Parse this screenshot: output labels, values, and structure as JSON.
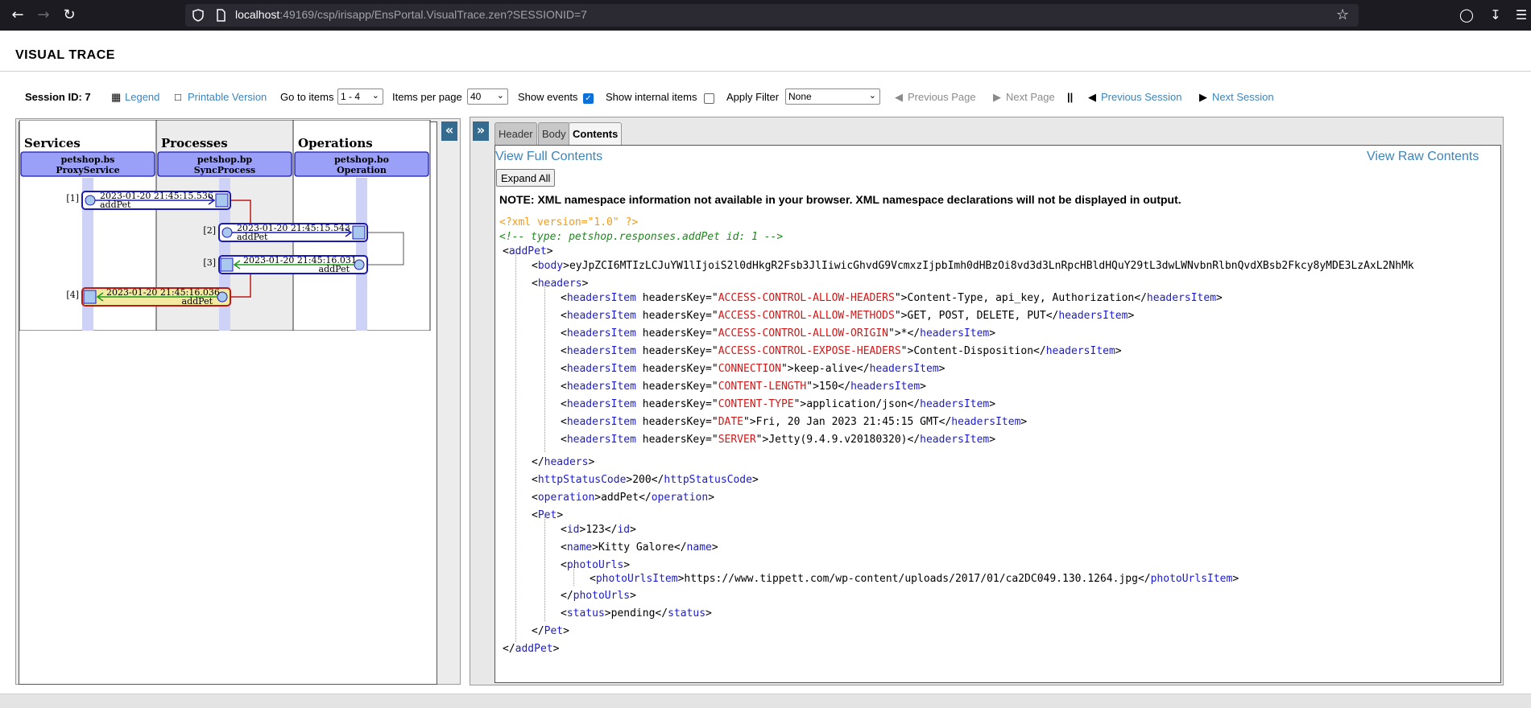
{
  "browser": {
    "url_host": "localhost",
    "url_rest": ":49169/csp/irisapp/EnsPortal.VisualTrace.zen?SESSIONID=7"
  },
  "page": {
    "title": "VISUAL TRACE"
  },
  "toolbar": {
    "session_id": "Session ID: 7",
    "legend": "Legend",
    "printable": "Printable Version",
    "goto_label": "Go to items",
    "goto_value": "1 - 4",
    "per_page_label": "Items per page",
    "per_page_value": "40",
    "show_events_label": "Show events",
    "show_events_checked": true,
    "show_internal_label": "Show internal items",
    "show_internal_checked": false,
    "apply_filter_label": "Apply Filter",
    "filter_value": "None",
    "prev_page": "Previous Page",
    "next_page": "Next Page",
    "separator": "||",
    "prev_session": "Previous Session",
    "next_session": "Next Session"
  },
  "trace": {
    "columns": [
      {
        "heading": "Services",
        "host_name": "petshop.bs",
        "host_class": "ProxyService"
      },
      {
        "heading": "Processes",
        "host_name": "petshop.bp",
        "host_class": "SyncProcess"
      },
      {
        "heading": "Operations",
        "host_name": "petshop.bo",
        "host_class": "Operation"
      }
    ],
    "messages": [
      {
        "index": "[1]",
        "time": "2023-01-20 21:45:15.536",
        "name": "addPet"
      },
      {
        "index": "[2]",
        "time": "2023-01-20 21:45:15.543",
        "name": "addPet"
      },
      {
        "index": "[3]",
        "time": "2023-01-20 21:45:16.031",
        "name": "addPet"
      },
      {
        "index": "[4]",
        "time": "2023-01-20 21:45:16.036",
        "name": "addPet"
      }
    ]
  },
  "tabs": [
    {
      "label": "Header",
      "active": false
    },
    {
      "label": "Body",
      "active": false
    },
    {
      "label": "Contents",
      "active": true
    }
  ],
  "content": {
    "view_full": "View Full Contents",
    "view_raw": "View Raw Contents",
    "expand_all": "Expand All",
    "ns_note": "NOTE: XML namespace information not available in your browser. XML namespace declarations will not be displayed in output.",
    "xml_decl": "<?xml version=\"1.0\" ?>",
    "comment": "<!-- type: petshop.responses.addPet  id: 1 -->",
    "root_tag": "addPet",
    "body_tag": "body",
    "body_text": "eyJpZCI6MTIzLCJuYW1lIjoiS2l0dHkgR2Fsb3JlIiwicGhvdG9VcmxzIjpbImh0dHBzOi8vd3d3LnRpcHBldHQuY29tL3dwLWNvbnRlbnQvdXBsb2Fkcy8yMDE3LzAxL2NhMk",
    "headers_tag": "headers",
    "header_item_tag": "headersItem",
    "header_key_attr": "headersKey",
    "header_items": [
      {
        "key": "ACCESS-CONTROL-ALLOW-HEADERS",
        "value": "Content-Type, api_key, Authorization"
      },
      {
        "key": "ACCESS-CONTROL-ALLOW-METHODS",
        "value": "GET, POST, DELETE, PUT"
      },
      {
        "key": "ACCESS-CONTROL-ALLOW-ORIGIN",
        "value": "*"
      },
      {
        "key": "ACCESS-CONTROL-EXPOSE-HEADERS",
        "value": "Content-Disposition"
      },
      {
        "key": "CONNECTION",
        "value": "keep-alive"
      },
      {
        "key": "CONTENT-LENGTH",
        "value": "150"
      },
      {
        "key": "CONTENT-TYPE",
        "value": "application/json"
      },
      {
        "key": "DATE",
        "value": "Fri, 20 Jan 2023 21:45:15 GMT"
      },
      {
        "key": "SERVER",
        "value": "Jetty(9.4.9.v20180320)"
      }
    ],
    "status_tag": "httpStatusCode",
    "status_value": "200",
    "operation_tag": "operation",
    "operation_value": "addPet",
    "pet_tag": "Pet",
    "id_tag": "id",
    "id_value": "123",
    "name_tag": "name",
    "name_value": "Kitty Galore",
    "photo_urls_tag": "photoUrls",
    "photo_item_tag": "photoUrlsItem",
    "photo_url": "https://www.tippett.com/wp-content/uploads/2017/01/ca2DC049.130.1264.jpg",
    "status_field_tag": "status",
    "status_field_value": "pending"
  },
  "colors": {
    "accent_link": "#3b84bc",
    "panel_button": "#356b8e",
    "xml_tag": "#1b1bd0",
    "xml_attr_value": "#d01818",
    "xml_comment": "#1a8a1a",
    "xml_decl": "#f49a1a",
    "trace_host_fill": "#9aa0f7",
    "trace_call": "#1a1ab8",
    "trace_return": "#1a9a1a",
    "trace_link": "#b81a1a",
    "trace_last_fill": "#f2eaa0"
  }
}
